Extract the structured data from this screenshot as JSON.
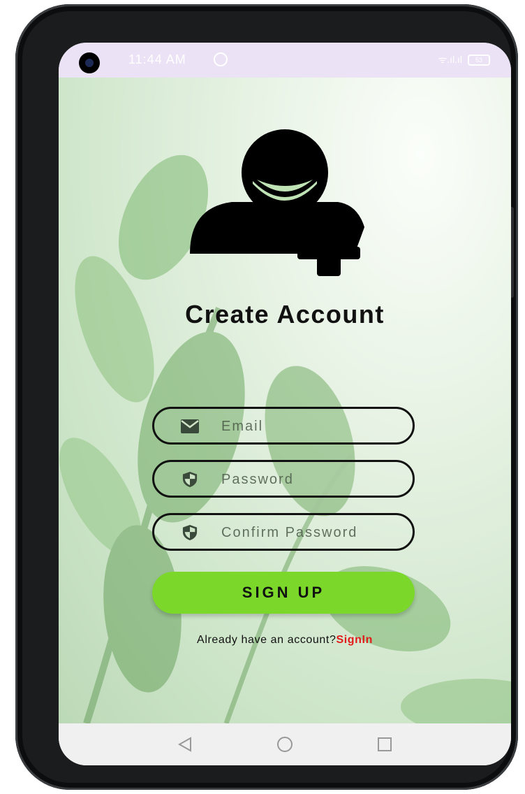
{
  "status_bar": {
    "time": "11:44 AM",
    "signal_text": "ᯤ.ıl.ıl",
    "battery": "53"
  },
  "signup": {
    "title": "Create Account",
    "fields": [
      {
        "placeholder": "Email",
        "icon": "mail-icon"
      },
      {
        "placeholder": "Password",
        "icon": "shield-icon"
      },
      {
        "placeholder": "Confirm Password",
        "icon": "shield-icon"
      }
    ],
    "button_label": "SIGN UP",
    "footer_text": "Already have an account?",
    "footer_link": "SignIn"
  },
  "nav": {
    "back": "◁",
    "home": "○",
    "recents": "□"
  },
  "colors": {
    "button": "#7bd82a",
    "link": "#e21b1b",
    "status_bar": "#ebe2f5"
  }
}
